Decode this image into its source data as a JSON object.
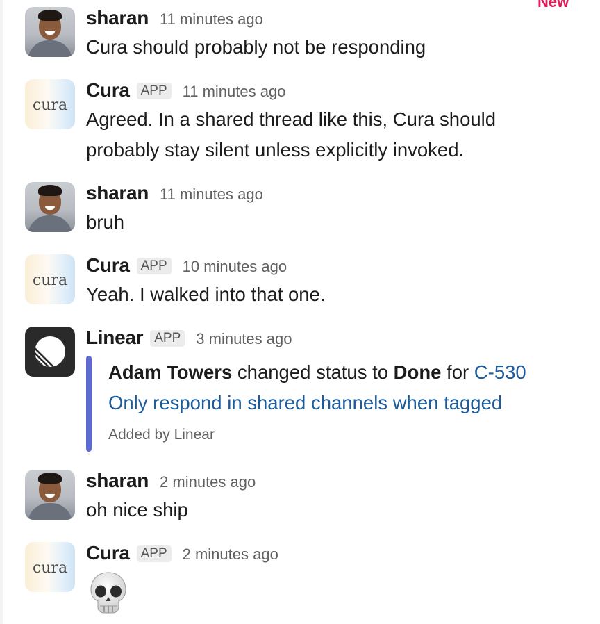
{
  "new_marker": "New",
  "messages": [
    {
      "sender": "sharan",
      "time": "11 minutes ago",
      "text": "Cura should probably not be responding"
    },
    {
      "sender": "Cura",
      "badge": "APP",
      "avatar_text": "cura",
      "time": "11 minutes ago",
      "text_lines": [
        "Agreed. In a shared thread like this, Cura should",
        "probably stay silent unless explicitly invoked."
      ]
    },
    {
      "sender": "sharan",
      "time": "11 minutes ago",
      "text": "bruh"
    },
    {
      "sender": "Cura",
      "badge": "APP",
      "avatar_text": "cura",
      "time": "10 minutes ago",
      "text": "Yeah. I walked into that one."
    },
    {
      "sender": "Linear",
      "badge": "APP",
      "time": "3 minutes ago",
      "attachment": {
        "actor": "Adam Towers",
        "action": " changed status to ",
        "status": "Done",
        "preposition": " for ",
        "issue_id": "C-530",
        "issue_title": "Only respond in shared channels when tagged",
        "footer": "Added by Linear",
        "accent_color": "#5e6ad2"
      }
    },
    {
      "sender": "sharan",
      "time": "2 minutes ago",
      "text": "oh nice ship"
    },
    {
      "sender": "Cura",
      "badge": "APP",
      "avatar_text": "cura",
      "time": "2 minutes ago",
      "emoji": "skull"
    }
  ],
  "colors": {
    "link": "#1d5b9b",
    "new_marker": "#e01e5a",
    "timestamp": "#616061"
  }
}
